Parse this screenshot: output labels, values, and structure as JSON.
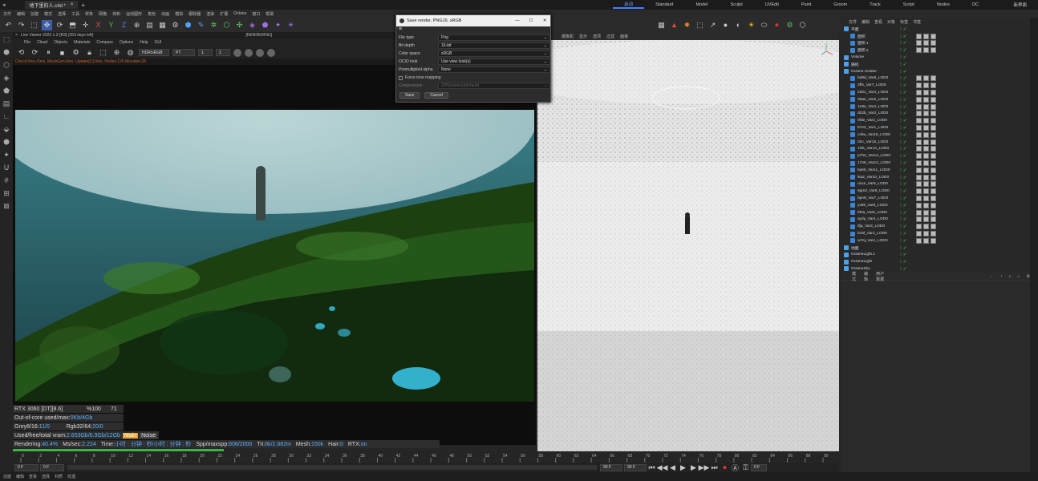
{
  "window": {
    "title": "地下里的人.c4d *"
  },
  "menubar": [
    "文件",
    "编辑",
    "创建",
    "模式",
    "选择",
    "工具",
    "样条",
    "网格",
    "体积",
    "运动图形",
    "角色",
    "动画",
    "模拟",
    "跟踪器",
    "渲染",
    "扩展",
    "Octane",
    "窗口",
    "帮助"
  ],
  "layouts": [
    "启动",
    "Standard",
    "Model",
    "Sculpt",
    "UVEdit",
    "Paint",
    "Groom",
    "Track",
    "Script",
    "Nodes",
    "OC"
  ],
  "layout_active": "启动",
  "new_layout_label": "新界面",
  "live_viewer": {
    "header": "Live Viewer 2022.1.2-[R3] (353 days left)",
    "state": "[RENDERING]",
    "menu": [
      "File",
      "Cloud",
      "Objects",
      "Materials",
      "Compare",
      "Options",
      "Help",
      "GUI"
    ],
    "colorspace": "HDR/sRGB",
    "kernel": "PT",
    "val1": "1",
    "val2": "1",
    "status": "Check:0ms./0ms. MeshGen:0ms. Update[C]:0ms. Nodes:126 Movable:28"
  },
  "render_stats": {
    "gpu": "RTX 3060 [DT][8.6]",
    "pct": "%100",
    "temp": "71",
    "ooc_label": "Out-of-core used/max:",
    "ooc_val": "0Kb/4Gb",
    "grey_label": "Grey8/16: ",
    "grey_val": "11/0",
    "rgb_label": "Rgb32/64: ",
    "rgb_val": "20/0",
    "vram_label": "Used/free/total vram: ",
    "vram_val": "2.653Gb/6.9Gb/12Gb",
    "main_btn": "Main",
    "noise_btn": "Noise",
    "rendering_label": "Rendering: ",
    "rendering_val": "40.4%",
    "ms_label": "Ms/sec: ",
    "ms_val": "2.224",
    "time_label": "Time: ",
    "time_val": "小时 : 分钟 : 秒/小时 : 分钟 : 秒",
    "spp_label": "Spp/maxspp: ",
    "spp_val": "808/2000",
    "tri_label": "Tri: ",
    "tri_val": "8k/2.682m",
    "mesh_label": "Mesh: ",
    "mesh_val": "150k",
    "hair_label": "Hair: ",
    "hair_val": "0",
    "rtx_label": "RTX:",
    "rtx_val": "on",
    "progress": 0.404
  },
  "save_dialog": {
    "title": "Save render, PNG16, sRGB",
    "rows": [
      {
        "label": "File type",
        "value": "Png"
      },
      {
        "label": "Bit depth",
        "value": "16-bit"
      },
      {
        "label": "Color space",
        "value": "sRGB"
      },
      {
        "label": "OCIO look",
        "value": "Use view look(s)"
      },
      {
        "label": "Premultiplied alpha",
        "value": "None"
      }
    ],
    "force_tone": "Force tone mapping",
    "compression_label": "Compression",
    "compression_val": "ZIP(lossless)(default)",
    "save": "Save",
    "cancel": "Cancel"
  },
  "viewport": {
    "menu": [
      "摄像机",
      "显示",
      "选项",
      "过滤",
      "面板"
    ]
  },
  "object_manager": {
    "menu": [
      "文件",
      "编辑",
      "查看",
      "对象",
      "标签",
      "书签"
    ],
    "items": [
      {
        "name": "平面",
        "indent": 0
      },
      {
        "name": "面积",
        "indent": 1
      },
      {
        "name": "面积.1",
        "indent": 1
      },
      {
        "name": "面积.2",
        "indent": 1
      },
      {
        "name": "Volume",
        "indent": 0
      },
      {
        "name": "摄机",
        "indent": 0
      },
      {
        "name": "Octane Scatter",
        "indent": 0
      },
      {
        "name": "bd8d_Var8_LOD0",
        "indent": 1
      },
      {
        "name": "3ffe_Var7_LOD0",
        "indent": 1
      },
      {
        "name": "22b1_Var4_LOD0",
        "indent": 1
      },
      {
        "name": "38ae_Var5_LOD0",
        "indent": 1
      },
      {
        "name": "1e8e_Var4_LOD0",
        "indent": 1
      },
      {
        "name": "d22b_Var3_LOD0",
        "indent": 1
      },
      {
        "name": "0fde_Var2_LOD0",
        "indent": 1
      },
      {
        "name": "57e2_Var1_LOD0",
        "indent": 1
      },
      {
        "name": "c46u_Var16_LOD0",
        "indent": 1
      },
      {
        "name": "t3rc_Var15_LOD0",
        "indent": 1
      },
      {
        "name": "1l4k_Var14_LOD0",
        "indent": 1
      },
      {
        "name": "p7h2_Var13_LOD0",
        "indent": 1
      },
      {
        "name": "17n6_Var12_LOD0",
        "indent": 1
      },
      {
        "name": "by60_Var11_LOD0",
        "indent": 1
      },
      {
        "name": "ika2_Var10_LOD0",
        "indent": 1
      },
      {
        "name": "uxce_Var9_LOD0",
        "indent": 1
      },
      {
        "name": "6gm2_Var8_LOD0",
        "indent": 1
      },
      {
        "name": "bpn9_Var7_LOD0",
        "indent": 1
      },
      {
        "name": "yx9k_Var6_LOD0",
        "indent": 1
      },
      {
        "name": "5hta_Var5_LOD0",
        "indent": 1
      },
      {
        "name": "ay3y_Var4_LOD0",
        "indent": 1
      },
      {
        "name": "tfja_Var3_LOD0",
        "indent": 1
      },
      {
        "name": "b16l_Var2_LOD0",
        "indent": 1
      },
      {
        "name": "w7ej_Var1_LOD0",
        "indent": 1
      },
      {
        "name": "地面",
        "indent": 0
      },
      {
        "name": "OctaneLight.1",
        "indent": 0
      },
      {
        "name": "OctaneLight",
        "indent": 0
      },
      {
        "name": "OctaneSky",
        "indent": 0
      }
    ]
  },
  "attr_manager": {
    "menu": [
      "模式",
      "编辑",
      "用户数据"
    ]
  },
  "timeline": {
    "ticks": [
      "0",
      "2",
      "4",
      "6",
      "8",
      "10",
      "12",
      "14",
      "16",
      "18",
      "20",
      "22",
      "24",
      "26",
      "28",
      "30",
      "32",
      "34",
      "36",
      "38",
      "40",
      "42",
      "44",
      "46",
      "48",
      "50",
      "52",
      "54",
      "56",
      "58",
      "60",
      "62",
      "64",
      "66",
      "68",
      "70",
      "72",
      "74",
      "76",
      "78",
      "80",
      "82",
      "84",
      "86",
      "88",
      "90"
    ],
    "current_frame": "0 F",
    "start": "0 F",
    "start2": "0 F",
    "end": "90 F",
    "end2": "90 F",
    "right_frame": "0 F"
  },
  "bottom": [
    "创建",
    "编辑",
    "查看",
    "选择",
    "材质",
    "纹理"
  ],
  "colors": {
    "accent": "#4a7cff",
    "progress": "#3fb04a",
    "stat_blue": "#5bb2ff"
  }
}
